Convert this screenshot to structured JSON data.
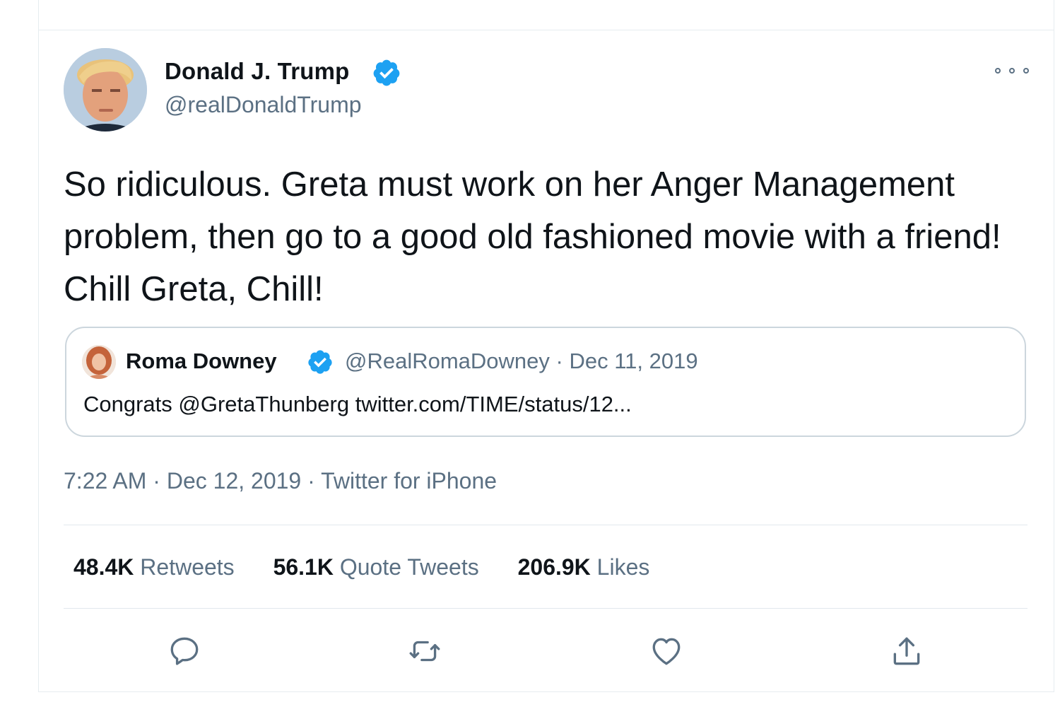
{
  "tweet": {
    "author_name": "Donald J. Trump",
    "author_handle": "@realDonaldTrump",
    "text": "So ridiculous. Greta must work on her Anger Management problem, then go to a good old fashioned movie with a friend! Chill Greta, Chill!",
    "time": "7:22 AM",
    "date": "Dec 12, 2019",
    "source": "Twitter for iPhone",
    "separator": "·"
  },
  "quote": {
    "author_name": "Roma Downey",
    "author_handle": "@RealRomaDowney",
    "date": "Dec 11, 2019",
    "text": "Congrats @GretaThunberg twitter.com/TIME/status/12..."
  },
  "stats": {
    "retweets_count": "48.4K",
    "retweets_label": "Retweets",
    "quotes_count": "56.1K",
    "quotes_label": "Quote Tweets",
    "likes_count": "206.9K",
    "likes_label": "Likes"
  },
  "icons": {
    "verified": "verified-badge-icon",
    "more": "more-options-icon",
    "reply": "reply-icon",
    "retweet": "retweet-icon",
    "like": "heart-icon",
    "share": "share-icon"
  },
  "colors": {
    "verified_blue": "#1da1f2",
    "secondary_text": "#5b7083",
    "primary_text": "#0f1419",
    "border": "#ccd6dd"
  }
}
